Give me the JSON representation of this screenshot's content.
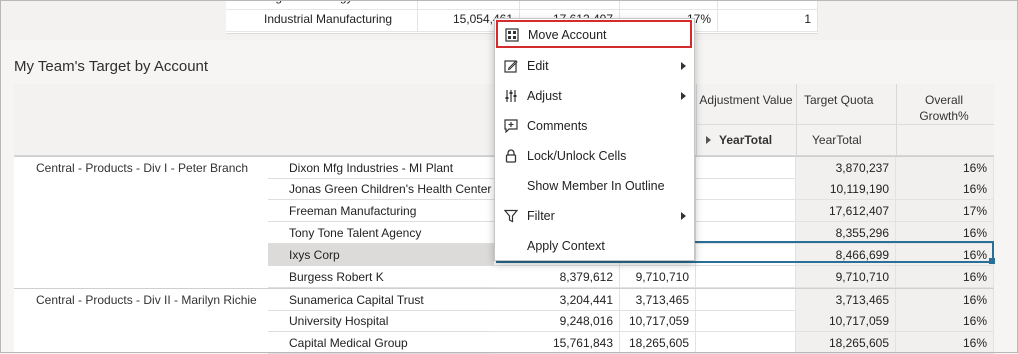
{
  "prev_form": {
    "rows": [
      {
        "name": "High Technology",
        "v1": "",
        "v2": "",
        "v3": "",
        "v4": ""
      },
      {
        "name": "Industrial Manufacturing",
        "v1": "15,054,461",
        "v2": "17,612,407",
        "v3": "17%",
        "v4": "1"
      }
    ]
  },
  "section": {
    "title": "My Team's Target by Account"
  },
  "columns": {
    "adjustment_value": "Adjustment Value",
    "target_quota": "Target Quota",
    "overall_growth": "Overall Growth%",
    "year_total_bold": "YearTotal",
    "year_total": "YearTotal"
  },
  "rows": [
    {
      "group": "Central - Products - Div I - Peter Branch",
      "account": "Dixon Mfg Industries - MI Plant",
      "c1": "",
      "c2": "",
      "c3": "",
      "target": "3,870,237",
      "growth": "16%"
    },
    {
      "group": "",
      "account": "Jonas Green Children's Health Center",
      "c1": "",
      "c2": "",
      "c3": "",
      "target": "10,119,190",
      "growth": "16%"
    },
    {
      "group": "",
      "account": "Freeman Manufacturing",
      "c1": "",
      "c2": "",
      "c3": "",
      "target": "17,612,407",
      "growth": "17%"
    },
    {
      "group": "",
      "account": "Tony Tone Talent Agency",
      "c1": "",
      "c2": "",
      "c3": "",
      "target": "8,355,296",
      "growth": "16%"
    },
    {
      "group": "",
      "account": "Ixys Corp",
      "c1": "",
      "c2": "",
      "c3": "",
      "target": "8,466,699",
      "growth": "16%"
    },
    {
      "group": "",
      "account": "Burgess Robert K",
      "c1": "8,379,612",
      "c2": "9,710,710",
      "c3": "",
      "target": "9,710,710",
      "growth": "16%"
    },
    {
      "group": "Central - Products - Div II - Marilyn Richie",
      "account": "Sunamerica Capital Trust",
      "c1": "3,204,441",
      "c2": "3,713,465",
      "c3": "",
      "target": "3,713,465",
      "growth": "16%"
    },
    {
      "group": "",
      "account": "University Hospital",
      "c1": "9,248,016",
      "c2": "10,717,059",
      "c3": "",
      "target": "10,717,059",
      "growth": "16%"
    },
    {
      "group": "",
      "account": "Capital Medical Group",
      "c1": "15,761,843",
      "c2": "18,265,605",
      "c3": "",
      "target": "18,265,605",
      "growth": "16%"
    }
  ],
  "context_menu": {
    "items": [
      {
        "label": "Move Account",
        "icon": "move-account-icon",
        "submenu": false
      },
      {
        "label": "Edit",
        "icon": "edit-icon",
        "submenu": true
      },
      {
        "label": "Adjust",
        "icon": "adjust-icon",
        "submenu": true
      },
      {
        "label": "Comments",
        "icon": "comments-icon",
        "submenu": false
      },
      {
        "label": "Lock/Unlock Cells",
        "icon": "lock-icon",
        "submenu": false
      },
      {
        "label": "Show Member In Outline",
        "icon": "",
        "submenu": false
      },
      {
        "label": "Filter",
        "icon": "filter-icon",
        "submenu": true
      },
      {
        "label": "Apply Context",
        "icon": "",
        "submenu": false
      }
    ]
  },
  "colors": {
    "highlight_border": "#d52b2b",
    "selection": "#2a6f97"
  }
}
